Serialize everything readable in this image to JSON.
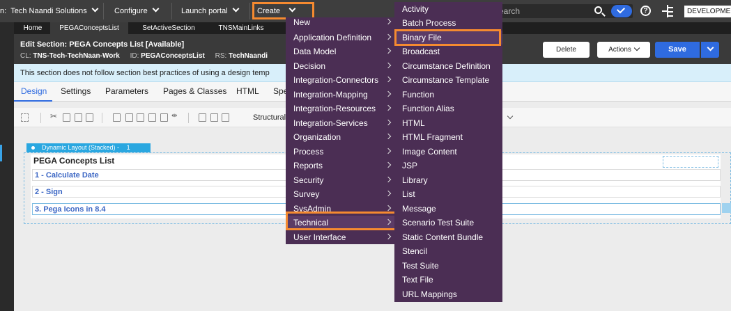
{
  "topbar": {
    "app_prefix": "n:",
    "app_name": "Tech Naandi Solutions",
    "configure": "Configure",
    "launch_portal": "Launch portal",
    "create": "Create",
    "search_placeholder": "earch",
    "environment": "DEVELOPMENT"
  },
  "tabs": [
    "Home",
    "PEGAConceptsList",
    "SetActiveSection",
    "TNSMainLinks"
  ],
  "header": {
    "title": "Edit  Section: PEGA Concepts List [Available]",
    "cl_label": "CL:",
    "cl_value": "TNS-Tech-TechNaan-Work",
    "id_label": "ID:",
    "id_value": "PEGAConceptsList",
    "rs_label": "RS:",
    "rs_value": "TechNaandi",
    "delete": "Delete",
    "actions": "Actions",
    "save": "Save"
  },
  "banner": "This section does not follow section best practices of using a design temp",
  "subtabs": [
    "Design",
    "Settings",
    "Parameters",
    "Pages & Classes",
    "HTML",
    "Spe"
  ],
  "toolbar": {
    "structural": "Structural"
  },
  "canvas": {
    "layout_tag": "Dynamic Layout (Stacked) -",
    "layout_number": "1",
    "section_title": "PEGA Concepts List",
    "rows": [
      "1 - Calculate Date",
      "2 - Sign",
      "3. Pega Icons in 8.4"
    ]
  },
  "menu_create": {
    "items": [
      "New",
      "Application Definition",
      "Data Model",
      "Decision",
      "Integration-Connectors",
      "Integration-Mapping",
      "Integration-Resources",
      "Integration-Services",
      "Organization",
      "Process",
      "Reports",
      "Security",
      "Survey",
      "SysAdmin",
      "Technical",
      "User Interface"
    ],
    "highlighted": "Technical"
  },
  "menu_technical": {
    "items": [
      "Activity",
      "Batch Process",
      "Binary File",
      "Broadcast",
      "Circumstance Definition",
      "Circumstance Template",
      "Function",
      "Function Alias",
      "HTML",
      "HTML Fragment",
      "Image Content",
      "JSP",
      "Library",
      "List",
      "Message",
      "Scenario Test Suite",
      "Static Content Bundle",
      "Stencil",
      "Test Suite",
      "Text File",
      "URL Mappings"
    ],
    "highlighted": "Binary File"
  },
  "colors": {
    "menu_bg": "#4b2e54",
    "highlight_ring": "#f58a30",
    "primary": "#2f6be0",
    "topbar_bg": "#3e3e3e"
  }
}
